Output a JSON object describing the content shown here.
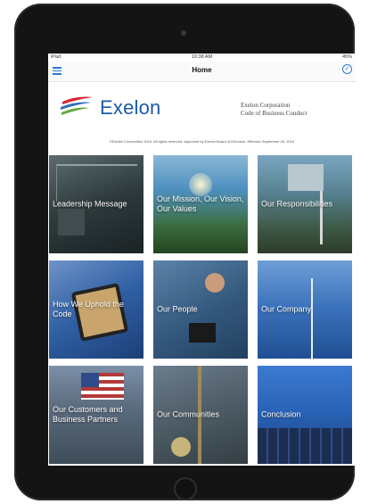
{
  "status_bar": {
    "carrier": "iPad",
    "time": "10:38 AM",
    "battery": "45%"
  },
  "nav": {
    "title": "Home",
    "menu_icon": "hamburger-menu-icon",
    "right_icon": "check-circle-icon"
  },
  "header": {
    "logo_text": "Exelon",
    "company_line1": "Exelon Corporation",
    "company_line2": "Code of Business Conduct",
    "copyright": "©Exelon Corporation 2016. All rights reserved. Approved by Exelon Board of Directors. Effective September 26, 2016"
  },
  "tiles": [
    {
      "label": "Leadership Message"
    },
    {
      "label": "Our Mission, Our Vision, Our Values"
    },
    {
      "label": "Our Responsibilities"
    },
    {
      "label": "How We Uphold the Code"
    },
    {
      "label": "Our People"
    },
    {
      "label": "Our Company"
    },
    {
      "label": "Our Customers and Business Partners"
    },
    {
      "label": "Our Communities"
    },
    {
      "label": "Conclusion"
    }
  ],
  "colors": {
    "accent": "#2d7ad6",
    "brand": "#1c5aa6",
    "bezel": "#141414"
  }
}
